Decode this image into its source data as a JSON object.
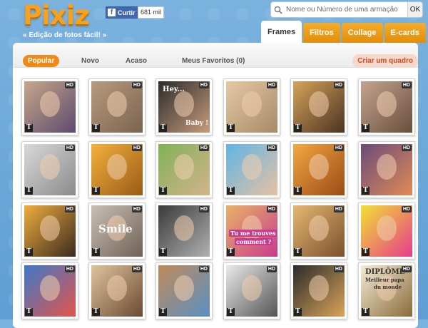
{
  "header": {
    "logo": "Pixiz",
    "tagline": "« Edição de fotos fácil! »",
    "facebook_like_label": "Curtir",
    "facebook_like_count": "681 mil",
    "search_placeholder": "Nome ou Número de uma armação",
    "search_button": "OK"
  },
  "tabs": [
    {
      "label": "Frames",
      "active": true
    },
    {
      "label": "Filtros",
      "active": false
    },
    {
      "label": "Collage",
      "active": false
    },
    {
      "label": "E-cards",
      "active": false
    }
  ],
  "filters": [
    {
      "label": "Popular",
      "active": true
    },
    {
      "label": "Novo",
      "active": false
    },
    {
      "label": "Acaso",
      "active": false
    },
    {
      "label": "Meus Favoritos (0)",
      "active": false
    }
  ],
  "create_frame_label": "Criar um quadro",
  "thumbnails": {
    "badge_hd": "HD",
    "badge_text": "T",
    "row1": [
      {
        "colors": [
          "#c7a78a",
          "#5c4a6e"
        ]
      },
      {
        "colors": [
          "#b89a7e",
          "#7a6450"
        ]
      },
      {
        "colors": [
          "#2b2b2b",
          "#c79b7c"
        ],
        "texts": [
          "Hey...",
          "Baby !"
        ]
      },
      {
        "colors": [
          "#e4c9a4",
          "#a78b68"
        ]
      },
      {
        "colors": [
          "#d6a35a",
          "#4a3322"
        ]
      },
      {
        "colors": [
          "#c2a490",
          "#6a4e3c"
        ]
      }
    ],
    "row2": [
      {
        "colors": [
          "#d9d9d9",
          "#8a8a8a"
        ]
      },
      {
        "colors": [
          "#f3b13c",
          "#9a5b16"
        ]
      },
      {
        "colors": [
          "#82b158",
          "#d2b48c"
        ]
      },
      {
        "colors": [
          "#5fb5e6",
          "#e7c1a3"
        ]
      },
      {
        "colors": [
          "#f3a842",
          "#9b4a15"
        ]
      },
      {
        "colors": [
          "#6a4b7a",
          "#e08a56"
        ]
      }
    ],
    "row3": [
      {
        "colors": [
          "#f0ad3d",
          "#3c2a1f"
        ]
      },
      {
        "colors": [
          "#c9bfb3",
          "#6f6257"
        ],
        "texts": [
          "Smile"
        ]
      },
      {
        "colors": [
          "#3a3a3a",
          "#b0b0b0"
        ]
      },
      {
        "colors": [
          "#e8b266",
          "#c83b8d"
        ],
        "texts": [
          "Tu me trouves",
          "comment ?"
        ]
      },
      {
        "colors": [
          "#e6b870",
          "#7a4f2e"
        ]
      },
      {
        "colors": [
          "#f2e033",
          "#e63c8a"
        ]
      }
    ],
    "row4": [
      {
        "colors": [
          "#3d78c9",
          "#e2564a"
        ]
      },
      {
        "colors": [
          "#e0c49d",
          "#6a4a33"
        ]
      },
      {
        "colors": [
          "#c08a5a",
          "#5a8fc3"
        ]
      },
      {
        "colors": [
          "#e9e9e9",
          "#555555"
        ]
      },
      {
        "colors": [
          "#2b2b2b",
          "#d9a45a"
        ]
      },
      {
        "colors": [
          "#f4ecd6",
          "#8a6a3a"
        ],
        "texts": [
          "DIPLÔME",
          "Meilleur papa",
          "du monde"
        ]
      }
    ]
  },
  "colors": {
    "accent": "#f08a17",
    "tab_orange": "#f5ad2c",
    "facebook": "#4267b2"
  }
}
